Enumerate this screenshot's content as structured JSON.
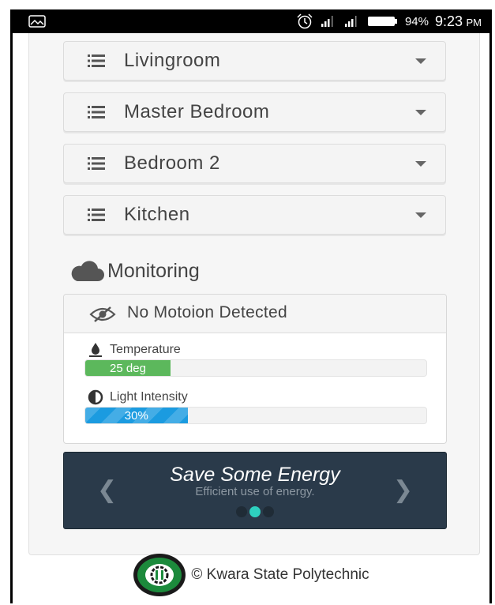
{
  "status_bar": {
    "battery_percent": "94%",
    "time": "9:23",
    "ampm": "PM",
    "colors": {
      "background": "#000000",
      "text": "#ffffff"
    }
  },
  "rooms": [
    {
      "label": "Livingroom"
    },
    {
      "label": "Master Bedroom"
    },
    {
      "label": "Bedroom 2"
    },
    {
      "label": "Kitchen"
    }
  ],
  "monitoring": {
    "title": "Monitoring",
    "motion_text": "No Motoion Detected",
    "temperature": {
      "label": "Temperature",
      "value_text": "25 deg",
      "fill_fraction": 0.25,
      "color": "#5cb85c"
    },
    "light": {
      "label": "Light Intensity",
      "value_text": "30%",
      "fill_fraction": 0.3,
      "color": "#1b9be0"
    }
  },
  "carousel": {
    "title": "Save Some Energy",
    "subtitle": "Efficient use of energy.",
    "prev_icon": "chevron-left-icon",
    "next_icon": "chevron-right-icon",
    "slide_count": 3,
    "active_index": 1,
    "colors": {
      "background": "#2a3a4a",
      "active_dot": "#2ed0bf"
    }
  },
  "footer": {
    "text": "© Kwara State Polytechnic",
    "logo_icon": "kwara-polytechnic-logo"
  }
}
